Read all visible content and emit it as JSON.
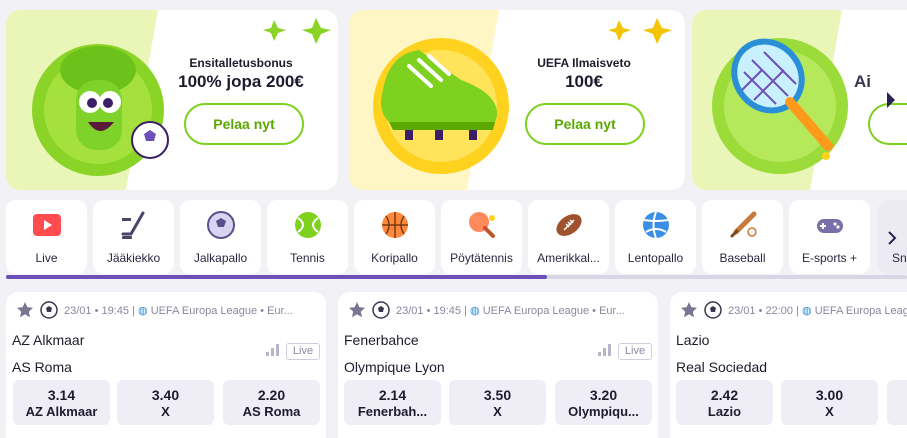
{
  "promos": [
    {
      "title": "Ensitalletusbonus",
      "value": "100% jopa 200€",
      "button": "Pelaa nyt",
      "art": "broccoli-mascot-icon"
    },
    {
      "title": "UEFA Ilmaisveto",
      "value": "100€",
      "button": "Pelaa nyt",
      "art": "football-boot-icon"
    },
    {
      "title": "Ai",
      "value": "",
      "button": "",
      "art": "tennis-racket-icon"
    }
  ],
  "colors": {
    "accent_green": "#7ed11e",
    "purple": "#6d4fb8",
    "card_bg": "#ffffff",
    "page_bg": "#f2f2f6"
  },
  "sports": [
    {
      "label": "Live",
      "icon": "live-play-icon"
    },
    {
      "label": "Jääkiekko",
      "icon": "hockey-stick-icon"
    },
    {
      "label": "Jalkapallo",
      "icon": "football-icon"
    },
    {
      "label": "Tennis",
      "icon": "tennis-ball-icon"
    },
    {
      "label": "Koripallo",
      "icon": "basketball-icon"
    },
    {
      "label": "Pöytätennis",
      "icon": "table-tennis-icon"
    },
    {
      "label": "Amerikkal...",
      "icon": "american-football-icon"
    },
    {
      "label": "Lentopallo",
      "icon": "volleyball-icon"
    },
    {
      "label": "Baseball",
      "icon": "baseball-icon"
    },
    {
      "label": "E-sports +",
      "icon": "gamepad-icon"
    },
    {
      "label": "Sn",
      "icon": "snooker-icon"
    }
  ],
  "nav_scroll_fraction": 0.6,
  "events": [
    {
      "date": "23/01",
      "time": "19:45",
      "competition": "UEFA Europa League",
      "extra": "• Eur...",
      "home": "AZ Alkmaar",
      "away": "AS Roma",
      "live": "Live",
      "odds": [
        {
          "value": "3.14",
          "label": "AZ Alkmaar"
        },
        {
          "value": "3.40",
          "label": "X"
        },
        {
          "value": "2.20",
          "label": "AS Roma"
        }
      ]
    },
    {
      "date": "23/01",
      "time": "19:45",
      "competition": "UEFA Europa League",
      "extra": "• Eur...",
      "home": "Fenerbahce",
      "away": "Olympique Lyon",
      "live": "Live",
      "odds": [
        {
          "value": "2.14",
          "label": "Fenerbah..."
        },
        {
          "value": "3.50",
          "label": "X"
        },
        {
          "value": "3.20",
          "label": "Olympiqu..."
        }
      ]
    },
    {
      "date": "23/01",
      "time": "22:00",
      "competition": "UEFA Europa League",
      "extra": "",
      "home": "Lazio",
      "away": "Real Sociedad",
      "live": "",
      "odds": [
        {
          "value": "2.42",
          "label": "Lazio"
        },
        {
          "value": "3.00",
          "label": "X"
        },
        {
          "value": "",
          "label": ""
        }
      ]
    }
  ]
}
